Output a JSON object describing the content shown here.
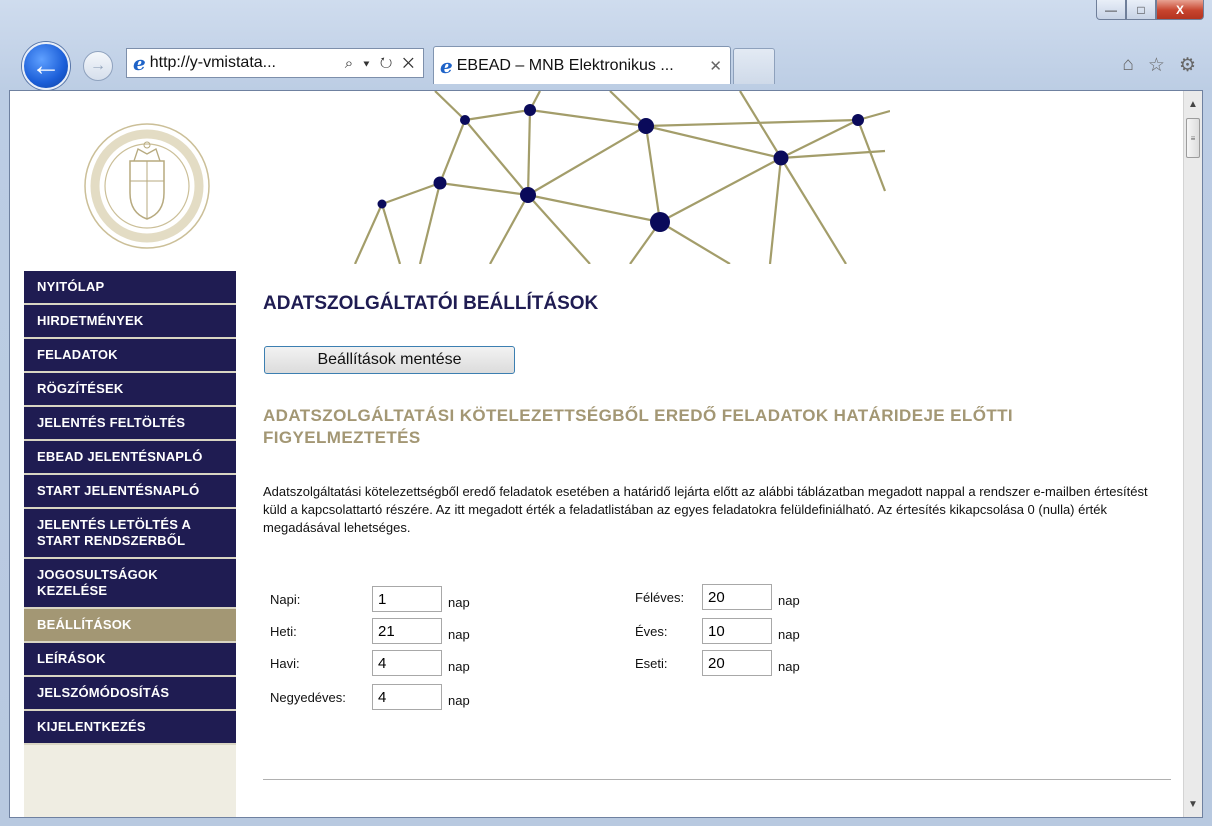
{
  "browser": {
    "address_url": "http://y-vmistata...",
    "address_tools": "⌕ ▾ ↻ ✕",
    "tab_title": "EBEAD – MNB Elektronikus ...",
    "tab_close": "✕",
    "window_buttons": {
      "minimize": "—",
      "maximize": "□",
      "close": "X"
    },
    "icons": [
      "home-icon",
      "star-icon",
      "gear-icon"
    ]
  },
  "sidebar": {
    "items": [
      {
        "label": "NYITÓLAP"
      },
      {
        "label": "HIRDETMÉNYEK"
      },
      {
        "label": "FELADATOK"
      },
      {
        "label": "RÖGZÍTÉSEK"
      },
      {
        "label": "JELENTÉS FELTÖLTÉS"
      },
      {
        "label": "EBEAD JELENTÉSNAPLÓ"
      },
      {
        "label": "START JELENTÉSNAPLÓ"
      },
      {
        "label": "JELENTÉS LETÖLTÉS A\nSTART RENDSZERBŐL"
      },
      {
        "label": "JOGOSULTSÁGOK\nKEZELÉSE"
      },
      {
        "label": "BEÁLLÍTÁSOK"
      },
      {
        "label": "LEÍRÁSOK"
      },
      {
        "label": "JELSZÓMÓDOSÍTÁS"
      },
      {
        "label": "KIJELENTKEZÉS"
      }
    ],
    "active_index": 9
  },
  "main": {
    "page_title": "ADATSZOLGÁLTATÓI BEÁLLÍTÁSOK",
    "save_button": "Beállítások mentése",
    "section_title": "ADATSZOLGÁLTATÁSI KÖTELEZETTSÉGBŐL EREDŐ FELADATOK HATÁRIDEJE ELŐTTI FIGYELMEZTETÉS",
    "description": "Adatszolgáltatási kötelezettségből eredő feladatok esetében a határidő lejárta előtt az alábbi táblázatban megadott nappal a rendszer e-mailben értesítést küld a kapcsolattartó részére. Az itt megadott érték a feladatlistában az egyes feladatokra felüldefiniálható. Az értesítés kikapcsolása 0 (nulla) érték megadásával lehetséges.",
    "unit": "nap",
    "fields": {
      "napi": {
        "label": "Napi:",
        "value": "1"
      },
      "heti": {
        "label": "Heti:",
        "value": "21"
      },
      "havi": {
        "label": "Havi:",
        "value": "4"
      },
      "negyedeves": {
        "label": "Negyedéves:",
        "value": "4"
      },
      "feleves": {
        "label": "Féléves:",
        "value": "20"
      },
      "eves": {
        "label": "Éves:",
        "value": "10"
      },
      "eseti": {
        "label": "Eseti:",
        "value": "20"
      }
    }
  },
  "colors": {
    "nav_bg": "#1f1c52",
    "nav_active": "#a39774",
    "section_title": "#a39774",
    "node": "#0a0a5a",
    "line": "#a39d6a"
  }
}
